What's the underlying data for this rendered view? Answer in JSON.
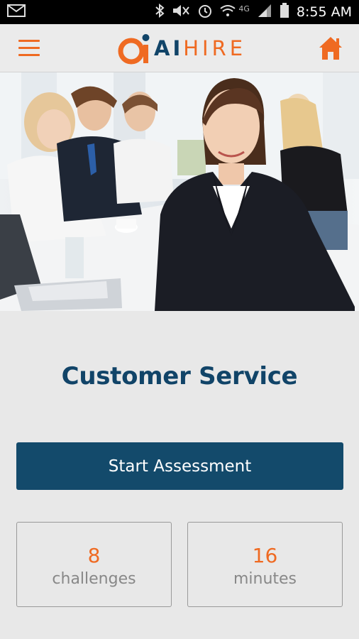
{
  "status_bar": {
    "time": "8:55 AM",
    "network": "4G",
    "icons": [
      "gmail-icon",
      "bluetooth-icon",
      "mute-icon",
      "alarm-icon",
      "wifi-icon",
      "signal-icon",
      "battery-icon"
    ]
  },
  "app_bar": {
    "logo_ai": "AI",
    "logo_hire": "HIRE",
    "colors": {
      "accent": "#ef6a22",
      "brand_dark": "#114468"
    }
  },
  "main": {
    "title": "Customer Service",
    "start_button": "Start Assessment",
    "stats": [
      {
        "value": "8",
        "label": "challenges"
      },
      {
        "value": "16",
        "label": "minutes"
      }
    ]
  }
}
